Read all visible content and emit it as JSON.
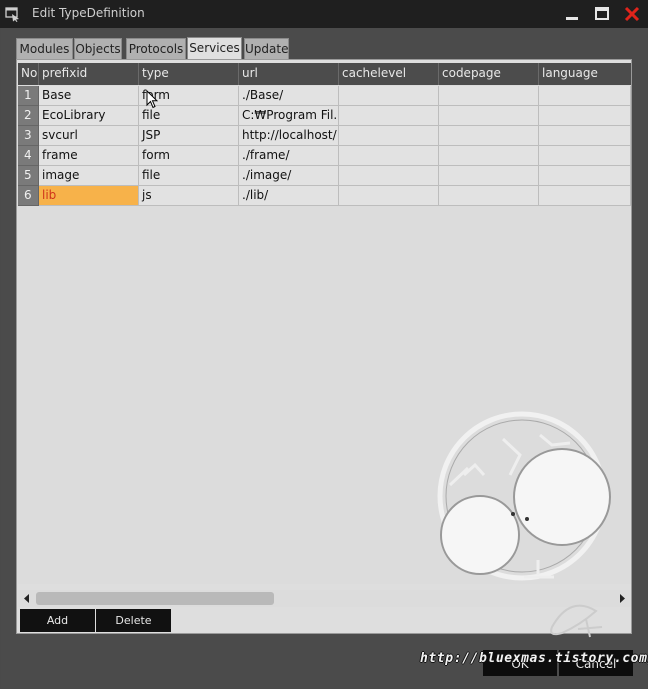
{
  "window": {
    "title": "Edit TypeDefinition",
    "icon": "app-window-icon",
    "controls": [
      "minimize-icon",
      "maximize-icon",
      "close-icon"
    ],
    "close_color": "#e0241b"
  },
  "tabs": [
    {
      "label": "Modules"
    },
    {
      "label": "Objects"
    },
    {
      "label": "Protocols"
    },
    {
      "label": "Services",
      "active": true
    },
    {
      "label": "Update"
    }
  ],
  "grid": {
    "columns": [
      "No",
      "prefixid",
      "type",
      "url",
      "cachelevel",
      "codepage",
      "language"
    ],
    "rows": [
      {
        "no": "1",
        "prefixid": "Base",
        "type": "form",
        "url": "./Base/",
        "cachelevel": "",
        "codepage": "",
        "language": ""
      },
      {
        "no": "2",
        "prefixid": "EcoLibrary",
        "type": "file",
        "url": "C:₩Program Fil...",
        "cachelevel": "",
        "codepage": "",
        "language": ""
      },
      {
        "no": "3",
        "prefixid": "svcurl",
        "type": "JSP",
        "url": "http://localhost/",
        "cachelevel": "",
        "codepage": "",
        "language": ""
      },
      {
        "no": "4",
        "prefixid": "frame",
        "type": "form",
        "url": "./frame/",
        "cachelevel": "",
        "codepage": "",
        "language": ""
      },
      {
        "no": "5",
        "prefixid": "image",
        "type": "file",
        "url": "./image/",
        "cachelevel": "",
        "codepage": "",
        "language": ""
      },
      {
        "no": "6",
        "prefixid": "lib",
        "type": "js",
        "url": "./lib/",
        "cachelevel": "",
        "codepage": "",
        "language": ""
      }
    ],
    "selected_row": 6,
    "selected_color": "#f7b24a"
  },
  "panel_buttons": {
    "add": "Add",
    "delete": "Delete"
  },
  "dialog_buttons": {
    "ok": "OK",
    "cancel": "Cancel"
  },
  "watermark": {
    "url": "http://bluexmas.tistory.com/"
  }
}
